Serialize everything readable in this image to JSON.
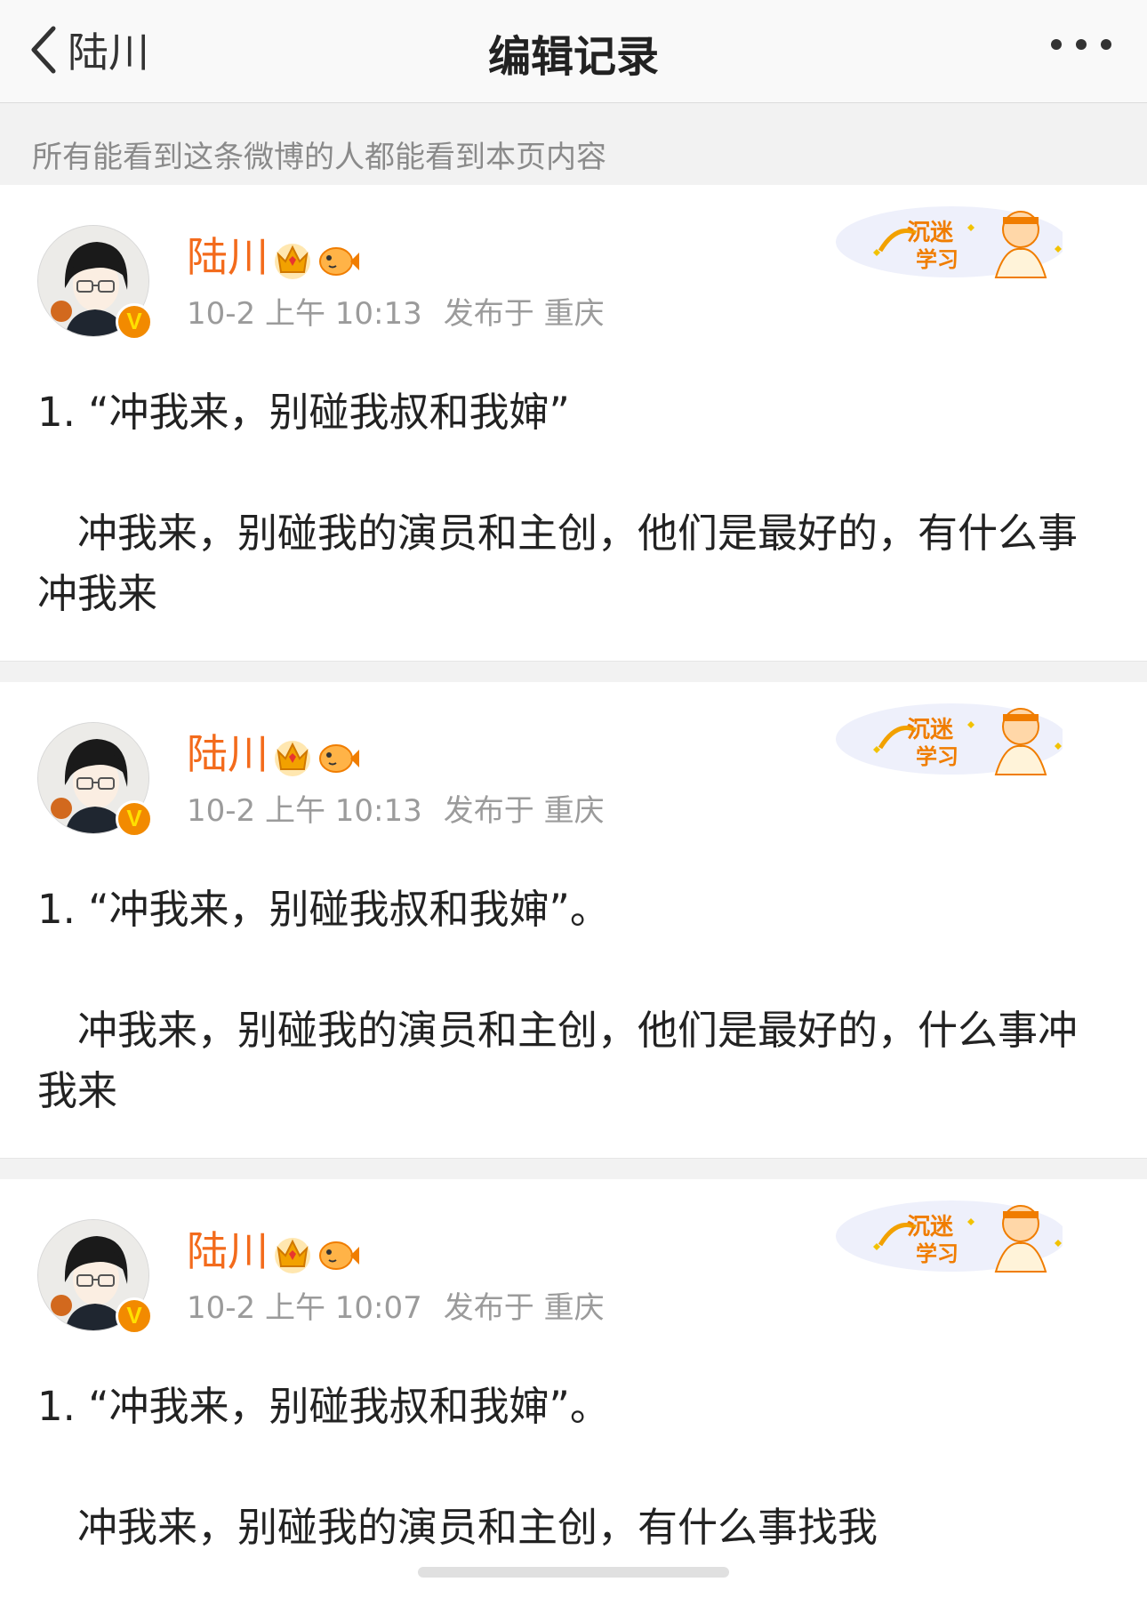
{
  "nav": {
    "back_label": "陆川",
    "title": "编辑记录"
  },
  "notice": "所有能看到这条微博的人都能看到本页内容",
  "records": [
    {
      "user": "陆川",
      "date": "10-2",
      "time": "上午 10:13",
      "published": "发布于",
      "location": "重庆",
      "line1": "1. “冲我来，别碰我叔和我婶”",
      "line2": "　冲我来，别碰我的演员和主创，他们是最好的，有什么事冲我来"
    },
    {
      "user": "陆川",
      "date": "10-2",
      "time": "上午 10:13",
      "published": "发布于",
      "location": "重庆",
      "line1": "1. “冲我来，别碰我叔和我婶”。",
      "line2": "　冲我来，别碰我的演员和主创，他们是最好的，什么事冲我来"
    },
    {
      "user": "陆川",
      "date": "10-2",
      "time": "上午 10:07",
      "published": "发布于",
      "location": "重庆",
      "line1": "1. “冲我来，别碰我叔和我婶”。",
      "line2": "　冲我来，别碰我的演员和主创，有什么事找我"
    }
  ],
  "colors": {
    "username": "#f36b1c",
    "meta": "#9b9b9b",
    "verified_badge": "#f28a00"
  }
}
